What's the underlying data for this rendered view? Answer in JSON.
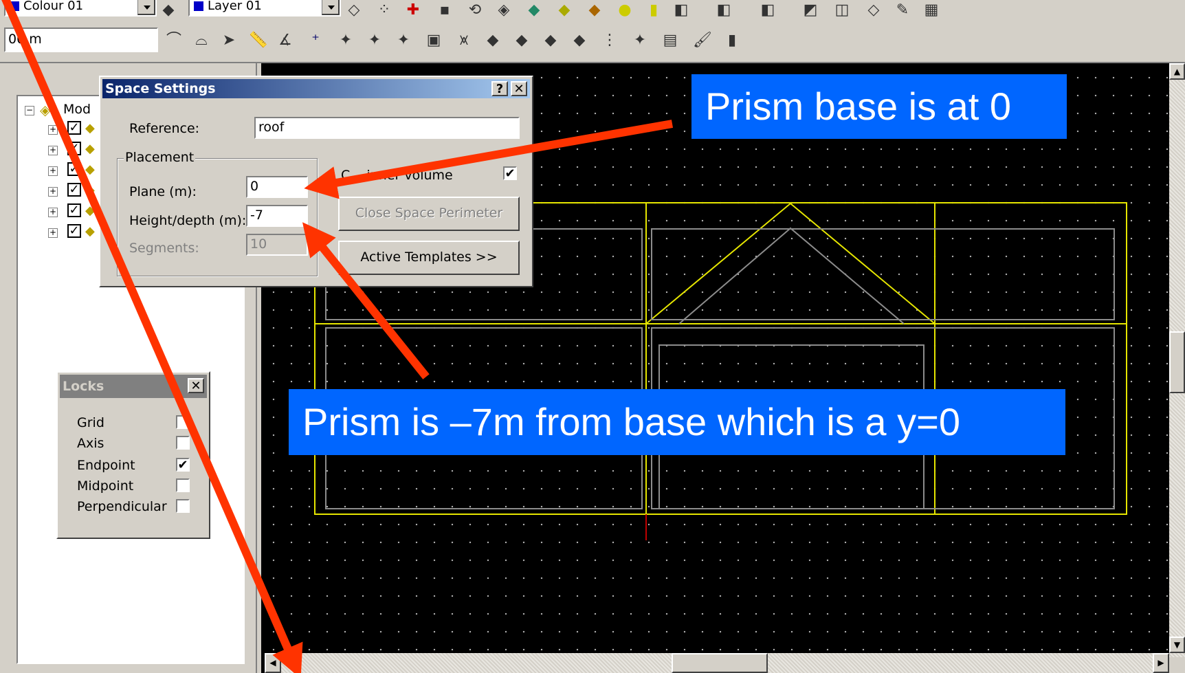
{
  "toolbar_top": {
    "colour_combo": "Colour 01",
    "layer_combo": "Layer 01"
  },
  "toolbar_second": {
    "value_field": "00 m"
  },
  "tree": {
    "root_label": "Mod"
  },
  "space_settings": {
    "title": "Space Settings",
    "help_label": "?",
    "close_label": "✕",
    "reference_label": "Reference:",
    "reference_value": "roof",
    "placement_group": "Placement",
    "plane_label": "Plane (m):",
    "plane_value": "0",
    "height_label": "Height/depth (m):",
    "height_value": "-7",
    "segments_label": "Segments:",
    "segments_value": "10",
    "inner_volume_label": "C... inner volume",
    "inner_volume_checked": "✔",
    "close_perimeter_button": "Close Space Perimeter",
    "active_templates_button": "Active Templates >>"
  },
  "locks": {
    "title": "Locks",
    "close_label": "✕",
    "items": [
      {
        "label": "Grid",
        "mark": ""
      },
      {
        "label": "Axis",
        "mark": ""
      },
      {
        "label": "Endpoint",
        "mark": "✔"
      },
      {
        "label": "Midpoint",
        "mark": ""
      },
      {
        "label": "Perpendicular",
        "mark": ""
      }
    ]
  },
  "callouts": {
    "top": "Prism base is at 0",
    "middle": "Prism is –7m from base which is a y=0"
  },
  "colors": {
    "callout_bg": "#0066ff",
    "arrow": "#ff3300",
    "outline": "#e6e600",
    "inner_lines": "#8c8c8c"
  }
}
